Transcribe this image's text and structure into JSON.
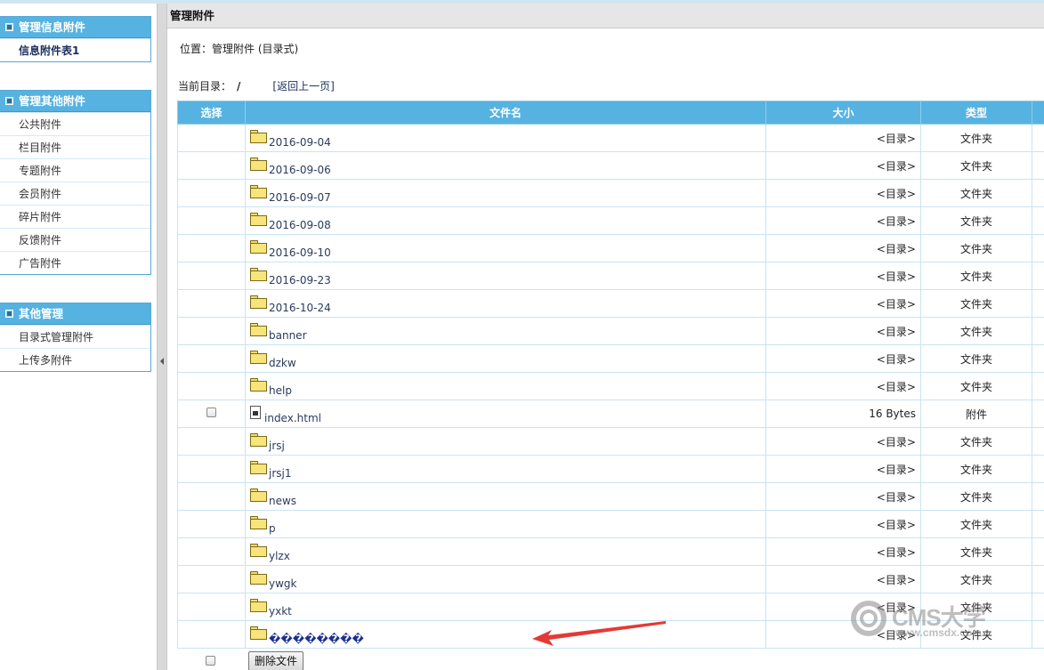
{
  "sidebar": {
    "groups": [
      {
        "title": "管理信息附件",
        "items": [
          "信息附件表1"
        ]
      },
      {
        "title": "管理其他附件",
        "items": [
          "公共附件",
          "栏目附件",
          "专题附件",
          "会员附件",
          "碎片附件",
          "反馈附件",
          "广告附件"
        ]
      },
      {
        "title": "其他管理",
        "items": [
          "目录式管理附件",
          "上传多附件"
        ]
      }
    ]
  },
  "main": {
    "title": "管理附件",
    "location": "位置：管理附件 (目录式)",
    "current_dir_label": "当前目录：",
    "current_dir": "/",
    "back_link": "[返回上一页]"
  },
  "table": {
    "headers": [
      "选择",
      "文件名",
      "大小",
      "类型"
    ],
    "rows": [
      {
        "name": "2016-09-04",
        "size": "<目录>",
        "type": "文件夹",
        "icon": "folder-icon",
        "checkbox": false
      },
      {
        "name": "2016-09-06",
        "size": "<目录>",
        "type": "文件夹",
        "icon": "folder-icon",
        "checkbox": false
      },
      {
        "name": "2016-09-07",
        "size": "<目录>",
        "type": "文件夹",
        "icon": "folder-icon",
        "checkbox": false
      },
      {
        "name": "2016-09-08",
        "size": "<目录>",
        "type": "文件夹",
        "icon": "folder-icon",
        "checkbox": false
      },
      {
        "name": "2016-09-10",
        "size": "<目录>",
        "type": "文件夹",
        "icon": "folder-icon",
        "checkbox": false
      },
      {
        "name": "2016-09-23",
        "size": "<目录>",
        "type": "文件夹",
        "icon": "folder-icon",
        "checkbox": false
      },
      {
        "name": "2016-10-24",
        "size": "<目录>",
        "type": "文件夹",
        "icon": "folder-icon",
        "checkbox": false
      },
      {
        "name": "banner",
        "size": "<目录>",
        "type": "文件夹",
        "icon": "folder-icon",
        "checkbox": false
      },
      {
        "name": "dzkw",
        "size": "<目录>",
        "type": "文件夹",
        "icon": "folder-icon",
        "checkbox": false
      },
      {
        "name": "help",
        "size": "<目录>",
        "type": "文件夹",
        "icon": "folder-icon",
        "checkbox": false
      },
      {
        "name": "index.html",
        "size": "16 Bytes",
        "type": "附件",
        "icon": "file-icon",
        "checkbox": true
      },
      {
        "name": "jrsj",
        "size": "<目录>",
        "type": "文件夹",
        "icon": "folder-icon",
        "checkbox": false
      },
      {
        "name": "jrsj1",
        "size": "<目录>",
        "type": "文件夹",
        "icon": "folder-icon",
        "checkbox": false
      },
      {
        "name": "news",
        "size": "<目录>",
        "type": "文件夹",
        "icon": "folder-icon",
        "checkbox": false
      },
      {
        "name": "p",
        "size": "<目录>",
        "type": "文件夹",
        "icon": "folder-icon",
        "checkbox": false
      },
      {
        "name": "ylzx",
        "size": "<目录>",
        "type": "文件夹",
        "icon": "folder-icon",
        "checkbox": false
      },
      {
        "name": "ywgk",
        "size": "<目录>",
        "type": "文件夹",
        "icon": "folder-icon",
        "checkbox": false
      },
      {
        "name": "yxkt",
        "size": "<目录>",
        "type": "文件夹",
        "icon": "folder-icon",
        "checkbox": false
      },
      {
        "name": "��������",
        "size": "<目录>",
        "type": "文件夹",
        "icon": "folder-icon",
        "checkbox": false,
        "garbled": true
      }
    ],
    "delete_button": "删除文件"
  },
  "watermark": {
    "title": "CMS大学",
    "url": "www.cmsdx.com"
  },
  "colors": {
    "header_blue": "#56b2e0",
    "annotation_red": "#e53935"
  }
}
